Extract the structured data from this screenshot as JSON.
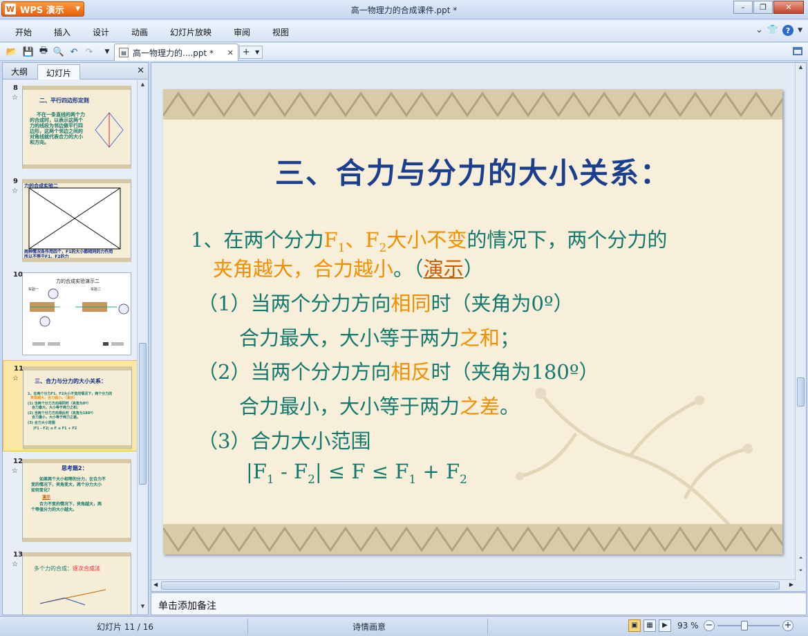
{
  "app": {
    "name": "WPS 演示",
    "logo_letter": "W"
  },
  "window": {
    "title": "高一物理力的合成课件.ppt *"
  },
  "menu": [
    "开始",
    "插入",
    "设计",
    "动画",
    "幻灯片放映",
    "审阅",
    "视图"
  ],
  "document_tab": {
    "label": "高一物理力的....ppt *"
  },
  "left_panel": {
    "tabs": [
      "大纲",
      "幻灯片"
    ],
    "thumbnails": [
      {
        "number": "8",
        "title": "二、平行四边形定则",
        "body": [
          "不在一条直线的两个力",
          "的合成时，以表示这两个",
          "力的线段为邻边做平行四",
          "边形，这两个邻边之间的",
          "对角线就代表合力的大小",
          "和方向。"
        ]
      },
      {
        "number": "9",
        "title": "力的合成实验二",
        "body": [
          "两种情况各作用四个，F1的大小都相同的力作用",
          "所以不等于F1、F2的力"
        ]
      },
      {
        "number": "10",
        "title": "力的合成实验演示二",
        "body": [
          "实验一",
          "实验二"
        ]
      },
      {
        "number": "11",
        "title": "三、合力与分力的大小关系：",
        "body": [
          "1、在两个分力F1、F2大小不变的情况下，两个分力的",
          "夹角越大，合力越小。（演示）",
          "(1) 当两个分力方向相同时（夹角为0º）",
          "合力最大，大小等于两力之和；",
          "(2) 当两个分力方向相反时（夹角为180º）",
          "合力最小，大小等于两力之差。",
          "(3) 合力大小范围",
          "|F1 - F2| ≤ F ≤ F1 + F2"
        ]
      },
      {
        "number": "12",
        "title": "思考题2：",
        "body": [
          "如果两个大小相等的分力，在合力不",
          "变的情况下，夹角变大，两个分力大小",
          "如何变化？",
          "演示",
          "合力不变的情况下，夹角越大，两",
          "个等值分力的大小越大。"
        ]
      },
      {
        "number": "13",
        "title": "多个力的合成：",
        "title_highlight": "逐次合成法",
        "body": []
      }
    ]
  },
  "slide": {
    "title": "三、合力与分力的大小关系：",
    "p1": {
      "a": "1、在两个分力",
      "f1": "F",
      "f1sub": "1",
      "sep": "、",
      "f2": "F",
      "f2sub": "2",
      "b": "大小不变",
      "c": "的情况下，两个分力的"
    },
    "p1b": {
      "a": "夹角越大",
      "b": "，",
      "c": "合力越小",
      "d": "。（",
      "link": "演示",
      "e": "）"
    },
    "p2": {
      "a": "（1）当两个分力方向",
      "b": "相同",
      "c": "时（夹角为0º）"
    },
    "p3": {
      "a": "合力最大，大小等于两力",
      "b": "之和",
      "c": "；"
    },
    "p4": {
      "a": "（2）当两个分力方向",
      "b": "相反",
      "c": "时（夹角为180º）"
    },
    "p5": {
      "a": "合力最小，大小等于两力",
      "b": "之差",
      "c": "。"
    },
    "p6": {
      "a": "（3）合力大小范围"
    },
    "p7": {
      "a": "|F",
      "s1": "1",
      "b": " - F",
      "s2": "2",
      "c": "|  ≤ F ≤ F",
      "s3": "1",
      "d": " + F",
      "s4": "2"
    }
  },
  "notes": {
    "placeholder": "单击添加备注"
  },
  "status": {
    "slide_info": "幻灯片 11 / 16",
    "theme": "诗情画意",
    "zoom": "93 %"
  },
  "colors": {
    "title_blue": "#1b3f8d",
    "text_teal": "#12786d",
    "highlight_orange": "#f18f00",
    "link_brown": "#c85b00"
  }
}
